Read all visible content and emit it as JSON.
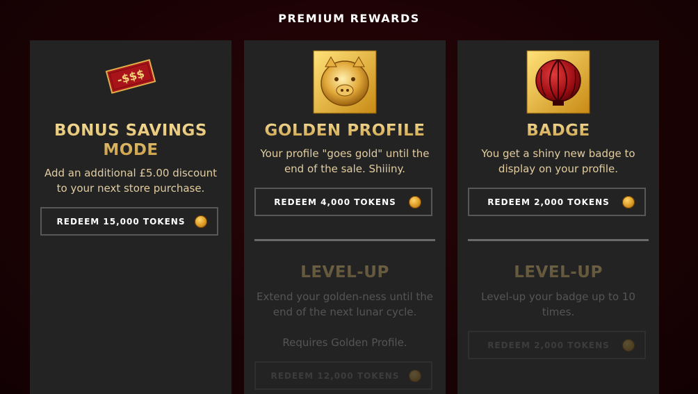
{
  "header": {
    "title": "PREMIUM REWARDS"
  },
  "cards": [
    {
      "title": "BONUS SAVINGS MODE",
      "description": "Add an additional £5.00 discount to your next store purchase.",
      "redeem_label": "REDEEM 15,000 TOKENS",
      "icon": "discount-tag-icon",
      "tag_text": "-$$$"
    },
    {
      "title": "GOLDEN PROFILE",
      "description": "Your profile \"goes gold\" until the end of the sale. Shiiiny.",
      "redeem_label": "REDEEM 4,000 TOKENS",
      "icon": "golden-pig-icon",
      "levelup": {
        "title": "LEVEL-UP",
        "description": "Extend your golden-ness until the end of the next lunar cycle.",
        "requirement": "Requires Golden Profile.",
        "redeem_label": "REDEEM 12,000 TOKENS"
      }
    },
    {
      "title": "BADGE",
      "description": "You get a shiny new badge to display on your profile.",
      "redeem_label": "REDEEM 2,000 TOKENS",
      "icon": "lantern-badge-icon",
      "levelup": {
        "title": "LEVEL-UP",
        "description": "Level-up your badge up to 10 times.",
        "redeem_label": "REDEEM 2,000 TOKENS"
      }
    }
  ],
  "colors": {
    "background": "#1a0204",
    "card": "#232323",
    "gold_text": "#e8c978",
    "desc_text": "#e2cda0",
    "dim_text": "#555555"
  }
}
